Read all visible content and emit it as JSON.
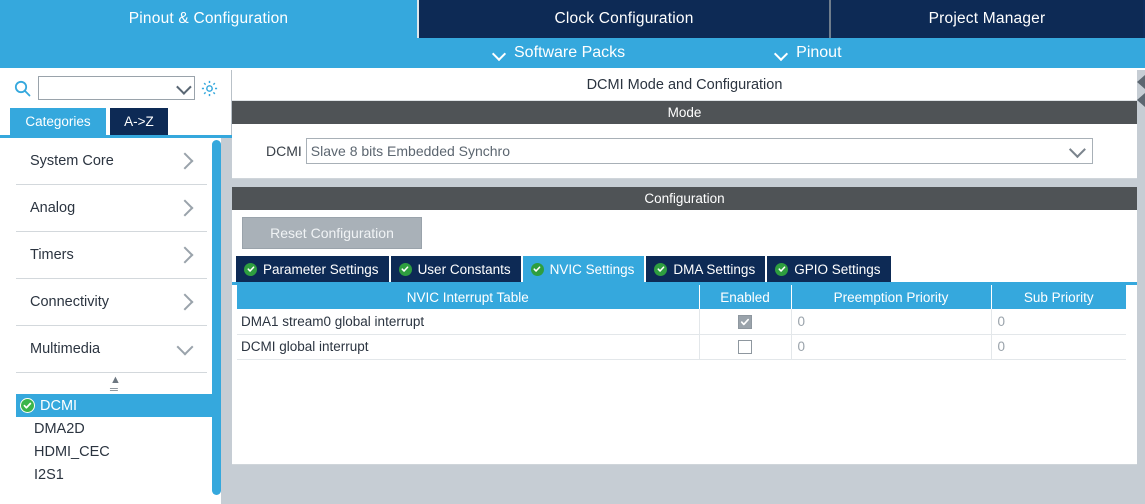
{
  "top_tabs": [
    {
      "label": "Pinout & Configuration",
      "active": true
    },
    {
      "label": "Clock Configuration",
      "active": false
    },
    {
      "label": "Project Manager",
      "active": false
    }
  ],
  "submenu": {
    "software_packs": "Software Packs",
    "pinout": "Pinout"
  },
  "sidebar": {
    "search": {
      "value": "",
      "placeholder": ""
    },
    "gear_tooltip": "",
    "view_tabs": [
      {
        "label": "Categories",
        "active": true
      },
      {
        "label": "A->Z",
        "active": false
      }
    ],
    "categories": [
      {
        "label": "System Core",
        "expanded": false
      },
      {
        "label": "Analog",
        "expanded": false
      },
      {
        "label": "Timers",
        "expanded": false
      },
      {
        "label": "Connectivity",
        "expanded": false
      },
      {
        "label": "Multimedia",
        "expanded": true
      }
    ],
    "multimedia_items": [
      {
        "label": "DCMI",
        "selected": true,
        "configured": true
      },
      {
        "label": "DMA2D",
        "selected": false,
        "configured": false
      },
      {
        "label": "HDMI_CEC",
        "selected": false,
        "configured": false
      },
      {
        "label": "I2S1",
        "selected": false,
        "configured": false
      }
    ]
  },
  "main": {
    "panel_title": "DCMI Mode and Configuration",
    "mode_header": "Mode",
    "mode_label": "DCMI",
    "mode_value": "Slave 8 bits Embedded Synchro",
    "configuration_header": "Configuration",
    "reset_button": "Reset Configuration",
    "config_tabs": [
      {
        "label": "Parameter Settings",
        "active": false
      },
      {
        "label": "User Constants",
        "active": false
      },
      {
        "label": "NVIC Settings",
        "active": true
      },
      {
        "label": "DMA Settings",
        "active": false
      },
      {
        "label": "GPIO Settings",
        "active": false
      }
    ],
    "nvic_table": {
      "columns": [
        "NVIC Interrupt Table",
        "Enabled",
        "Preemption Priority",
        "Sub Priority"
      ],
      "rows": [
        {
          "interrupt": "DMA1 stream0 global interrupt",
          "enabled": true,
          "preemption_priority": "0",
          "sub_priority": "0"
        },
        {
          "interrupt": "DCMI global interrupt",
          "enabled": false,
          "preemption_priority": "0",
          "sub_priority": "0"
        }
      ]
    }
  },
  "colors": {
    "accent_blue": "#35a8dd",
    "navy": "#0d2a55",
    "section_gray": "#4f5356",
    "green_check": "#2e9e3f",
    "button_gray": "#a9b1b8"
  }
}
